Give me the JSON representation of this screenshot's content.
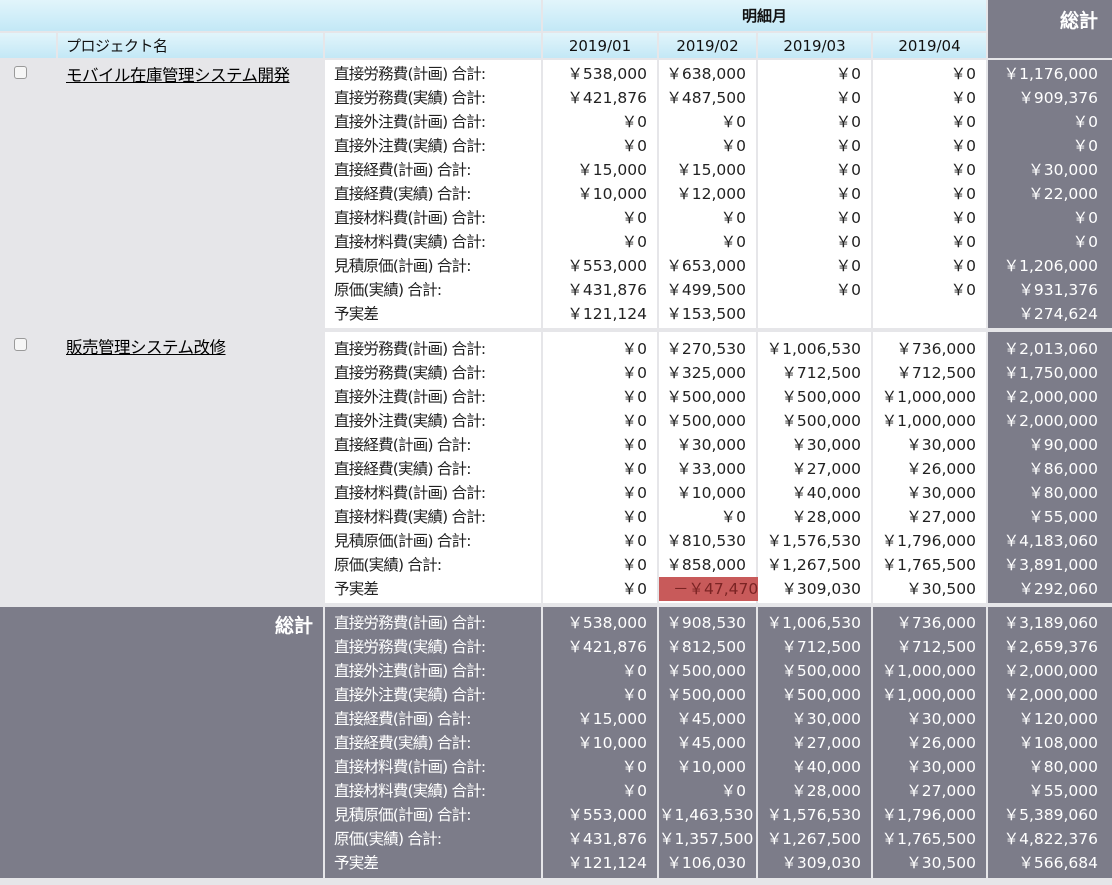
{
  "header": {
    "month_group": "明細月",
    "grand_total": "総計",
    "project_name": "プロジェクト名",
    "months": [
      "2019/01",
      "2019/02",
      "2019/03",
      "2019/04"
    ]
  },
  "row_labels": [
    "直接労務費(計画) 合計:",
    "直接労務費(実績) 合計:",
    "直接外注費(計画) 合計:",
    "直接外注費(実績) 合計:",
    "直接経費(計画) 合計:",
    "直接経費(実績) 合計:",
    "直接材料費(計画) 合計:",
    "直接材料費(実績) 合計:",
    "見積原価(計画) 合計:",
    "原価(実績) 合計:",
    "予実差"
  ],
  "projects": [
    {
      "name": "モバイル在庫管理システム開発",
      "months": [
        [
          "￥538,000",
          "￥421,876",
          "￥0",
          "￥0",
          "￥15,000",
          "￥10,000",
          "￥0",
          "￥0",
          "￥553,000",
          "￥431,876",
          "￥121,124"
        ],
        [
          "￥638,000",
          "￥487,500",
          "￥0",
          "￥0",
          "￥15,000",
          "￥12,000",
          "￥0",
          "￥0",
          "￥653,000",
          "￥499,500",
          "￥153,500"
        ],
        [
          "￥0",
          "￥0",
          "￥0",
          "￥0",
          "￥0",
          "￥0",
          "￥0",
          "￥0",
          "￥0",
          "￥0",
          ""
        ],
        [
          "￥0",
          "￥0",
          "￥0",
          "￥0",
          "￥0",
          "￥0",
          "￥0",
          "￥0",
          "￥0",
          "￥0",
          ""
        ]
      ],
      "total": [
        "￥1,176,000",
        "￥909,376",
        "￥0",
        "￥0",
        "￥30,000",
        "￥22,000",
        "￥0",
        "￥0",
        "￥1,206,000",
        "￥931,376",
        "￥274,624"
      ]
    },
    {
      "name": "販売管理システム改修",
      "months": [
        [
          "￥0",
          "￥0",
          "￥0",
          "￥0",
          "￥0",
          "￥0",
          "￥0",
          "￥0",
          "￥0",
          "￥0",
          "￥0"
        ],
        [
          "￥270,530",
          "￥325,000",
          "￥500,000",
          "￥500,000",
          "￥30,000",
          "￥33,000",
          "￥10,000",
          "￥0",
          "￥810,530",
          "￥858,000",
          "－￥47,470"
        ],
        [
          "￥1,006,530",
          "￥712,500",
          "￥500,000",
          "￥500,000",
          "￥30,000",
          "￥27,000",
          "￥40,000",
          "￥28,000",
          "￥1,576,530",
          "￥1,267,500",
          "￥309,030"
        ],
        [
          "￥736,000",
          "￥712,500",
          "￥1,000,000",
          "￥1,000,000",
          "￥30,000",
          "￥26,000",
          "￥30,000",
          "￥27,000",
          "￥1,796,000",
          "￥1,765,500",
          "￥30,500"
        ]
      ],
      "total": [
        "￥2,013,060",
        "￥1,750,000",
        "￥2,000,000",
        "￥2,000,000",
        "￥90,000",
        "￥86,000",
        "￥80,000",
        "￥55,000",
        "￥4,183,060",
        "￥3,891,000",
        "￥292,060"
      ]
    }
  ],
  "grand": {
    "label": "総計",
    "months": [
      [
        "￥538,000",
        "￥421,876",
        "￥0",
        "￥0",
        "￥15,000",
        "￥10,000",
        "￥0",
        "￥0",
        "￥553,000",
        "￥431,876",
        "￥121,124"
      ],
      [
        "￥908,530",
        "￥812,500",
        "￥500,000",
        "￥500,000",
        "￥45,000",
        "￥45,000",
        "￥10,000",
        "￥0",
        "￥1,463,530",
        "￥1,357,500",
        "￥106,030"
      ],
      [
        "￥1,006,530",
        "￥712,500",
        "￥500,000",
        "￥500,000",
        "￥30,000",
        "￥27,000",
        "￥40,000",
        "￥28,000",
        "￥1,576,530",
        "￥1,267,500",
        "￥309,030"
      ],
      [
        "￥736,000",
        "￥712,500",
        "￥1,000,000",
        "￥1,000,000",
        "￥30,000",
        "￥26,000",
        "￥30,000",
        "￥27,000",
        "￥1,796,000",
        "￥1,765,500",
        "￥30,500"
      ]
    ],
    "total": [
      "￥3,189,060",
      "￥2,659,376",
      "￥2,000,000",
      "￥2,000,000",
      "￥120,000",
      "￥108,000",
      "￥80,000",
      "￥55,000",
      "￥5,389,060",
      "￥4,822,376",
      "￥566,684"
    ]
  },
  "colors": {
    "header_bg": "#c3e8f6",
    "total_bg": "#7c7c89",
    "negative_bg": "#c85a5a"
  }
}
